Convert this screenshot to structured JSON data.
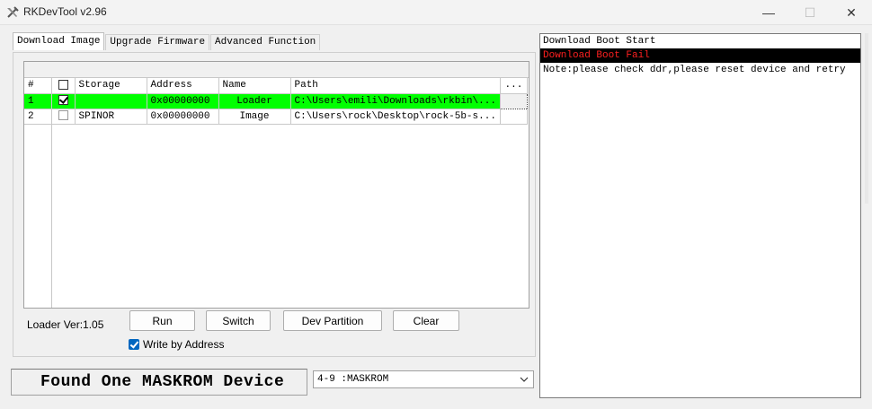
{
  "window": {
    "title": "RKDevTool v2.96",
    "minimize_glyph": "—",
    "maximize_glyph": "☐",
    "close_glyph": "✕"
  },
  "tabs": [
    {
      "label": "Download Image",
      "active": true
    },
    {
      "label": "Upgrade Firmware",
      "active": false
    },
    {
      "label": "Advanced Function",
      "active": false
    }
  ],
  "grid": {
    "columns": [
      "#",
      "",
      "Storage",
      "Address",
      "Name",
      "Path",
      "..."
    ],
    "rows": [
      {
        "num": "1",
        "checked": true,
        "storage": "",
        "address": "0x00000000",
        "name": "Loader",
        "path": "C:\\Users\\emili\\Downloads\\rkbin\\...",
        "selected": true
      },
      {
        "num": "2",
        "checked": false,
        "storage": "SPINOR",
        "address": "0x00000000",
        "name": "Image",
        "path": "C:\\Users\\rock\\Desktop\\rock-5b-s...",
        "selected": false
      }
    ]
  },
  "loader_version": "Loader Ver:1.05",
  "buttons": {
    "run": "Run",
    "switch": "Switch",
    "dev_partition": "Dev Partition",
    "clear": "Clear"
  },
  "write_by_address": {
    "label": "Write by Address",
    "checked": true
  },
  "status_text": "Found One MASKROM Device",
  "device_combo": {
    "value": "4-9 :MASKROM"
  },
  "log": [
    {
      "text": "Download Boot Start",
      "error": false
    },
    {
      "text": "Download Boot Fail",
      "error": true
    },
    {
      "text": "Note:please check ddr,please reset device and retry",
      "error": false
    }
  ],
  "colors": {
    "selected_row": "#00ff00",
    "error_text": "#ff2020",
    "error_bg": "#000000",
    "checkbox_accent": "#0067c0"
  }
}
